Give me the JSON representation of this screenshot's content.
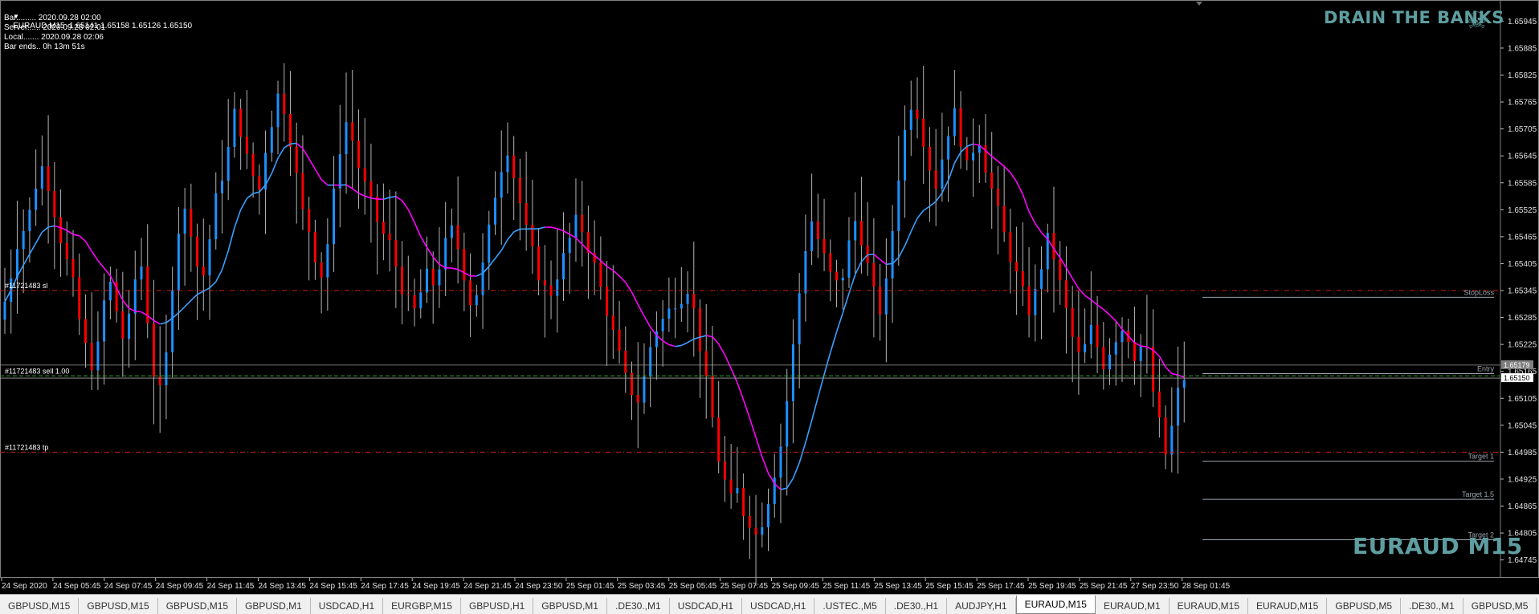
{
  "header": {
    "symbol_line": "EURAUD,M15  1.65141 1.65158 1.65126 1.65150",
    "info_lines": [
      "Bar......... 2020.09.28 02:00",
      "Server...... 2020.09.28 02:01",
      "Local....... 2020.09.28 02:06",
      "Bar ends.. 0h 13m 51s"
    ]
  },
  "branding": {
    "title": "DRAIN THE BANKS",
    "icon": "skull-crossbones-icon",
    "watermark": "EURAUD M15"
  },
  "price_axis": {
    "labels": [
      "1.65945",
      "1.65885",
      "1.65825",
      "1.65765",
      "1.65705",
      "1.65645",
      "1.65585",
      "1.65525",
      "1.65465",
      "1.65405",
      "1.65345",
      "1.65285",
      "1.65225",
      "1.65165",
      "1.65105",
      "1.65045",
      "1.64985",
      "1.64925",
      "1.64865",
      "1.64805",
      "1.64745"
    ],
    "current_bid": "1.65150",
    "current_ask": "1.65179"
  },
  "time_axis": [
    "24 Sep 2020",
    "24 Sep 05:45",
    "24 Sep 07:45",
    "24 Sep 09:45",
    "24 Sep 11:45",
    "24 Sep 13:45",
    "24 Sep 15:45",
    "24 Sep 17:45",
    "24 Sep 19:45",
    "24 Sep 21:45",
    "24 Sep 23:50",
    "25 Sep 01:45",
    "25 Sep 03:45",
    "25 Sep 05:45",
    "25 Sep 07:45",
    "25 Sep 09:45",
    "25 Sep 11:45",
    "25 Sep 13:45",
    "25 Sep 15:45",
    "25 Sep 17:45",
    "25 Sep 19:45",
    "25 Sep 21:45",
    "27 Sep 23:50",
    "28 Sep 01:45"
  ],
  "order_lines": {
    "sl_label": "#11721483 sl",
    "entry_label": "#11721483 sell 1.00",
    "tp_label": "#11721483 tp",
    "sl_price": 1.65345,
    "entry_price": 1.65155,
    "tp_price": 1.64985
  },
  "levels": [
    {
      "label": "StopLoss",
      "price": 1.6533
    },
    {
      "label": "Entry",
      "price": 1.6516
    },
    {
      "label": "Target 1",
      "price": 1.64965
    },
    {
      "label": "Target 1.5",
      "price": 1.6488
    },
    {
      "label": "Target 2",
      "price": 1.6479
    }
  ],
  "colors": {
    "background": "#000000",
    "bull": "#1e90ff",
    "bear": "#ff0000",
    "wick": "#b4b4b4",
    "ma_up": "#3aa0ff",
    "ma_down": "#ff00ff",
    "stop_lines": "#c81e1e",
    "entry_line": "#32a032",
    "brand": "#5f9ea0"
  },
  "tabs": [
    {
      "label": "GBPUSD,M15",
      "active": false
    },
    {
      "label": "GBPUSD,M15",
      "active": false
    },
    {
      "label": "GBPUSD,M15",
      "active": false
    },
    {
      "label": "GBPUSD,M1",
      "active": false
    },
    {
      "label": "USDCAD,H1",
      "active": false
    },
    {
      "label": "EURGBP,M15",
      "active": false
    },
    {
      "label": "GBPUSD,H1",
      "active": false
    },
    {
      "label": "GBPUSD,M1",
      "active": false
    },
    {
      "label": ".DE30.,M1",
      "active": false
    },
    {
      "label": "USDCAD,H1",
      "active": false
    },
    {
      "label": "USDCAD,H1",
      "active": false
    },
    {
      "label": ".USTEC.,M5",
      "active": false
    },
    {
      "label": ".DE30.,H1",
      "active": false
    },
    {
      "label": "AUDJPY,H1",
      "active": false
    },
    {
      "label": "EURAUD,M15",
      "active": true
    },
    {
      "label": "EURAUD,M1",
      "active": false
    },
    {
      "label": "EURAUD,M15",
      "active": false
    },
    {
      "label": "EURAUD,M15",
      "active": false
    },
    {
      "label": "GBPUSD,M5",
      "active": false
    },
    {
      "label": ".DE30.,M1",
      "active": false
    },
    {
      "label": "GBPUSD,M5",
      "active": false
    }
  ],
  "chart_data": {
    "type": "candlestick",
    "symbol": "EURAUD",
    "timeframe": "M15",
    "ylim": [
      1.64745,
      1.65945
    ],
    "close_path": [
      1.6532,
      1.6538,
      1.6545,
      1.6548,
      1.6552,
      1.6558,
      1.6562,
      1.6558,
      1.6552,
      1.6546,
      1.6541,
      1.6536,
      1.6528,
      1.6522,
      1.6518,
      1.6522,
      1.6532,
      1.6536,
      1.653,
      1.6524,
      1.6528,
      1.6537,
      1.654,
      1.6528,
      1.6516,
      1.6512,
      1.652,
      1.6536,
      1.6548,
      1.6552,
      1.6548,
      1.654,
      1.6538,
      1.6546,
      1.6555,
      1.656,
      1.6566,
      1.6574,
      1.657,
      1.6564,
      1.656,
      1.6557,
      1.6566,
      1.6572,
      1.6578,
      1.6575,
      1.6568,
      1.656,
      1.6552,
      1.6548,
      1.6542,
      1.6538,
      1.6545,
      1.6556,
      1.6566,
      1.6572,
      1.6568,
      1.6562,
      1.6558,
      1.6554,
      1.655,
      1.6547,
      1.6545,
      1.654,
      1.6535,
      1.6532,
      1.653,
      1.6534,
      1.6538,
      1.6536,
      1.654,
      1.6545,
      1.6548,
      1.6544,
      1.6538,
      1.6532,
      1.6534,
      1.654,
      1.6548,
      1.6556,
      1.6562,
      1.6566,
      1.656,
      1.6554,
      1.6548,
      1.6543,
      1.6538,
      1.6535,
      1.6534,
      1.6538,
      1.6542,
      1.6546,
      1.655,
      1.6548,
      1.6544,
      1.654,
      1.6535,
      1.653,
      1.6525,
      1.652,
      1.6515,
      1.6512,
      1.651,
      1.6515,
      1.6522,
      1.6526,
      1.6528,
      1.653,
      1.6532,
      1.6533,
      1.6535,
      1.653,
      1.6522,
      1.6514,
      1.6506,
      1.6497,
      1.6492,
      1.6488,
      1.649,
      1.6485,
      1.6483,
      1.648,
      1.6483,
      1.6488,
      1.6494,
      1.65,
      1.651,
      1.6522,
      1.6534,
      1.6544,
      1.655,
      1.6546,
      1.6542,
      1.6538,
      1.6536,
      1.6538,
      1.6545,
      1.655,
      1.6546,
      1.654,
      1.6534,
      1.653,
      1.6536,
      1.6548,
      1.656,
      1.657,
      1.6576,
      1.6574,
      1.6568,
      1.6562,
      1.6558,
      1.6564,
      1.657,
      1.6574,
      1.6568,
      1.6562,
      1.6566,
      1.6568,
      1.6562,
      1.6557,
      1.6552,
      1.6547,
      1.6542,
      1.6538,
      1.6534,
      1.653,
      1.6534,
      1.654,
      1.6546,
      1.6542,
      1.6536,
      1.653,
      1.6524,
      1.652,
      1.6522,
      1.6526,
      1.6522,
      1.6518,
      1.6521,
      1.6524,
      1.6526,
      1.6524,
      1.652,
      1.6522,
      1.6521,
      1.6512,
      1.6505,
      1.6498,
      1.6504,
      1.6512,
      1.6515
    ],
    "ma": {
      "name": "",
      "type": "line"
    }
  }
}
